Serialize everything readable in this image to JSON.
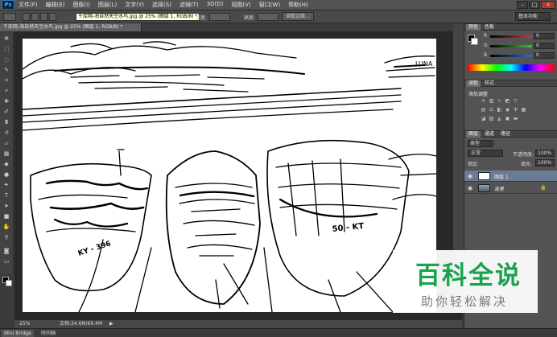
{
  "app": {
    "logo": "Ps",
    "window_controls": [
      "–",
      "□",
      "×"
    ]
  },
  "menu": [
    "文件(F)",
    "编辑(E)",
    "图像(I)",
    "图层(L)",
    "文字(Y)",
    "选择(S)",
    "滤镜(T)",
    "3D(D)",
    "视图(V)",
    "窗口(W)",
    "帮助(H)"
  ],
  "options_bar": {
    "tooltip": "千库网-海自然天空水鸟.jpg @ 25% (图层 1, RGB/8) *",
    "width_label": "宽度:",
    "height_label": "高度:",
    "refine_edge": "调整边缘...",
    "workspace": "基本功能"
  },
  "document": {
    "tab": "千库网-海自然天空水鸟.jpg @ 25% (图层 1, RGB/8) *",
    "zoom": "25%",
    "doc_size": "文档:34.6M/69.4M",
    "boat_left_text": "KY - 396",
    "boat_right_text": "50 - KT",
    "sign_text": "LUNA"
  },
  "toolbox": {
    "tools": [
      "move",
      "marquee",
      "lasso",
      "quick-select",
      "crop",
      "eyedropper",
      "healing-brush",
      "brush",
      "clone-stamp",
      "history-brush",
      "eraser",
      "gradient",
      "blur",
      "dodge",
      "pen",
      "type",
      "path-select",
      "shape",
      "hand",
      "zoom"
    ],
    "fg_color": "#000000",
    "bg_color": "#ffffff"
  },
  "panels": {
    "color": {
      "tabs": [
        "颜色",
        "色板"
      ],
      "channels": [
        {
          "label": "R",
          "value": "0",
          "color": "#d33"
        },
        {
          "label": "G",
          "value": "0",
          "color": "#3c3"
        },
        {
          "label": "B",
          "value": "0",
          "color": "#36d"
        }
      ]
    },
    "adjustments": {
      "tabs": [
        "调整",
        "样式"
      ],
      "title": "添加调整"
    },
    "layers": {
      "tabs": [
        "图层",
        "通道",
        "路径"
      ],
      "kind_label": "类型",
      "blend_mode": "正常",
      "opacity_label": "不透明度:",
      "opacity": "100%",
      "lock_label": "锁定:",
      "fill_label": "填充:",
      "fill": "100%",
      "items": [
        {
          "name": "图层 1",
          "selected": true
        },
        {
          "name": "背景",
          "selected": false
        }
      ]
    }
  },
  "mini_bridge": {
    "tabs": [
      "Mini Bridge",
      "时间轴"
    ]
  },
  "watermark": {
    "title": "百科全说",
    "subtitle": "助你轻松解决"
  }
}
